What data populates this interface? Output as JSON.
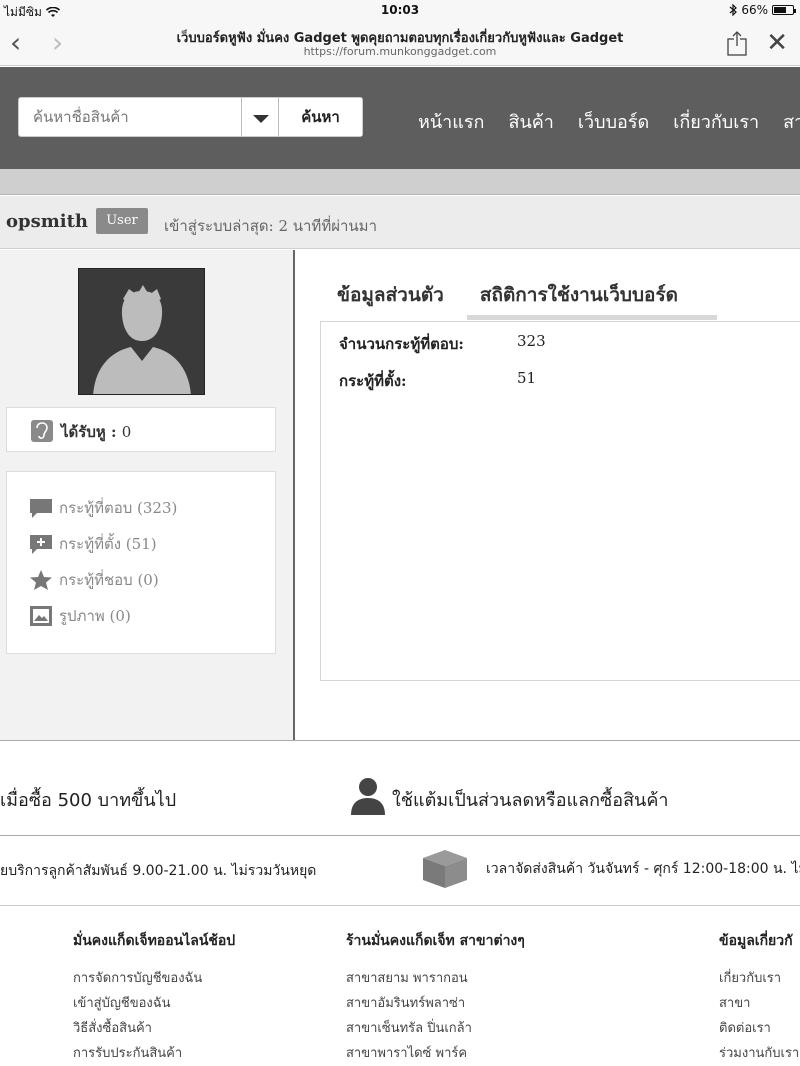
{
  "status_bar": {
    "carrier": "ไม่มีซิม",
    "time": "10:03",
    "battery": "66%",
    "battery_level": 0.66
  },
  "browser": {
    "page_title": "เว็บบอร์ดหูฟัง มั่นคง Gadget พูดคุยถามตอบทุกเรื่องเกี่ยวกับหูฟังและ Gadget",
    "url": "https://forum.munkonggadget.com"
  },
  "header": {
    "search_placeholder": "ค้นหาชื่อสินค้า",
    "search_button": "ค้นหา",
    "nav": [
      "หน้าแรก",
      "สินค้า",
      "เว็บบอร์ด",
      "เกี่ยวกับเรา",
      "สา"
    ]
  },
  "user": {
    "name": "opsmith",
    "role": "User",
    "last_login": "เข้าสู่ระบบล่าสุด: 2 นาทีที่ผ่านมา"
  },
  "sidebar": {
    "ear_label": "ได้รับหู :",
    "ear_value": "0",
    "stats": [
      {
        "label": "กระทู้ที่ตอบ (323)",
        "icon": "comment-icon"
      },
      {
        "label": "กระทู้ที่ตั้ง (51)",
        "icon": "add-comment-icon"
      },
      {
        "label": "กระทู้ที่ชอบ (0)",
        "icon": "star-icon"
      },
      {
        "label": "รูปภาพ (0)",
        "icon": "image-icon"
      }
    ]
  },
  "tabs": [
    "ข้อมูลส่วนตัว",
    "สถิติการใช้งานเว็บบอร์ด"
  ],
  "info": {
    "rows": [
      {
        "label": "จำนวนกระทู้ที่ตอบ:",
        "value": "323"
      },
      {
        "label": "กระทู้ที่ตั้ง:",
        "value": "51"
      }
    ]
  },
  "promo": {
    "left": "เมื่อซื้อ 500 บาทขึ้นไป",
    "right": "ใช้แต้มเป็นส่วนลดหรือแลกซื้อสินค้า"
  },
  "service": {
    "left": "ยบริการลูกค้าสัมพันธ์ 9.00-21.00 น. ไม่รวมวันหยุด",
    "right": "เวลาจัดส่งสินค้า วันจันทร์ - ศุกร์ 12:00-18:00 น. ไม่"
  },
  "footer": {
    "col1": {
      "title": "มั่นคงแก็ดเจ็ทออนไลน์ช้อป",
      "links": [
        "การจัดการบัญชีของฉัน",
        "เข้าสู่บัญชีของฉัน",
        "วิธีสั่งซื้อสินค้า",
        "การรับประกันสินค้า"
      ]
    },
    "col2": {
      "title": "ร้านมั่นคงแก็ดเจ็ท สาขาต่างๆ",
      "links": [
        "สาขาสยาม พารากอน",
        "สาขาอัมรินทร์พลาซ่า",
        "สาขาเซ็นทรัล ปิ่นเกล้า",
        "สาขาพาราไดซ์ พาร์ค"
      ]
    },
    "col3": {
      "title": "ข้อมูลเกี่ยวกั",
      "links": [
        "เกี่ยวกับเรา",
        "สาขา",
        "ติดต่อเรา",
        "ร่วมงานกับเรา"
      ]
    }
  }
}
